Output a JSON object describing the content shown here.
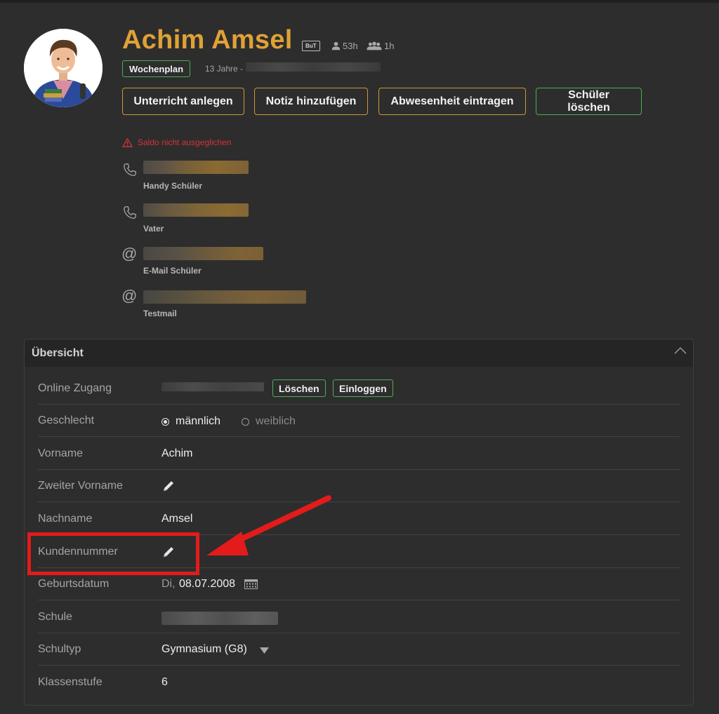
{
  "student": {
    "name": "Achim Amsel",
    "badge": "BuT",
    "stat_single": "53h",
    "stat_group": "1h",
    "tag": "Wochenplan",
    "age": "13 Jahre -"
  },
  "actions": {
    "add_lesson": "Unterricht anlegen",
    "add_note": "Notiz hinzufügen",
    "add_absence": "Abwesenheit eintragen",
    "delete_student": "Schüler löschen"
  },
  "warning": "Saldo nicht ausgeglichen",
  "contacts": [
    {
      "type": "phone",
      "label": "Handy Schüler"
    },
    {
      "type": "phone",
      "label": "Vater"
    },
    {
      "type": "email",
      "label": "E-Mail Schüler"
    },
    {
      "type": "email",
      "label": "Testmail"
    }
  ],
  "overview": {
    "title": "Übersicht",
    "online_access": {
      "label": "Online Zugang",
      "delete": "Löschen",
      "login": "Einloggen"
    },
    "gender": {
      "label": "Geschlecht",
      "options": [
        "männlich",
        "weiblich"
      ],
      "selected": "männlich"
    },
    "first_name": {
      "label": "Vorname",
      "value": "Achim"
    },
    "second_name": {
      "label": "Zweiter Vorname"
    },
    "last_name": {
      "label": "Nachname",
      "value": "Amsel"
    },
    "customer_no": {
      "label": "Kundennummer"
    },
    "birthdate": {
      "label": "Geburtsdatum",
      "weekday": "Di,",
      "value": "08.07.2008"
    },
    "school": {
      "label": "Schule"
    },
    "school_type": {
      "label": "Schultyp",
      "value": "Gymnasium (G8)"
    },
    "grade": {
      "label": "Klassenstufe",
      "value": "6"
    }
  },
  "colors": {
    "accent_gold": "#e0a135",
    "green": "#4caf50",
    "warning_red": "#d6323a",
    "annotation_red": "#e31b1b",
    "background": "#2d2d2d"
  }
}
